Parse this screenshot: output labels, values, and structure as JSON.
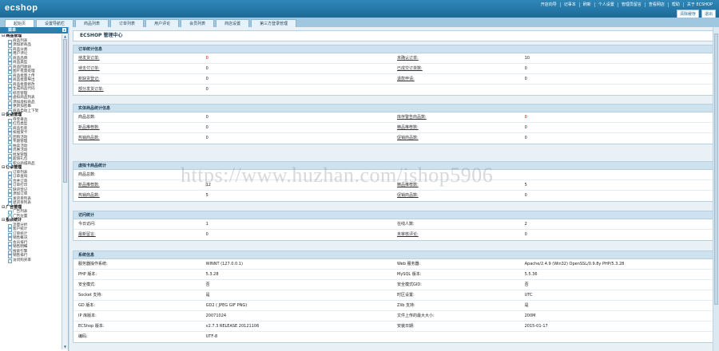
{
  "header": {
    "logo": "ecshop",
    "links": [
      "开店向导",
      "记事本",
      "刷新",
      "个人设置",
      "管理员留言",
      "查看网店",
      "帮助",
      "关于 ECSHOP"
    ],
    "buttons": [
      "清除缓存",
      "退出"
    ]
  },
  "nav": {
    "tabs": [
      "起始页",
      "设置导航栏",
      "商品列表",
      "订单列表",
      "用户评论",
      "会员列表",
      "商店设置",
      "第三方登录管理"
    ]
  },
  "sidebar": {
    "title": "菜单",
    "close": "x",
    "groups": [
      {
        "label": "商品管理",
        "items": [
          "商品列表",
          "添加新商品",
          "商品分类",
          "用户评论",
          "商品品牌",
          "商品类型",
          "商品回收站",
          "图片批量处理",
          "商品批量上传",
          "商品批量导出",
          "商品批量修改",
          "生成商品代码",
          "标签管理",
          "虚拟商品列表",
          "添加虚拟商品",
          "更新加密串",
          "商品自动上下架"
        ]
      },
      {
        "label": "促销管理",
        "items": [
          "夺宝奇兵",
          "红包类型",
          "商品包装",
          "祝福贺卡",
          "团购活动",
          "专题管理",
          "拍卖活动",
          "优惠活动",
          "批发管理",
          "超值礼包",
          "积分商城商品"
        ]
      },
      {
        "label": "订单管理",
        "items": [
          "订单列表",
          "订单查询",
          "合并订单",
          "订单打印",
          "缺货登记",
          "添加订单",
          "发货单列表",
          "退货单列表"
        ]
      },
      {
        "label": "广告管理",
        "items": [
          "广告列表",
          "广告位置"
        ]
      },
      {
        "label": "报表统计",
        "items": [
          "流量分析",
          "客户统计",
          "订单统计",
          "销售概况",
          "会员排行",
          "销售明细",
          "搜索引擎",
          "销售排行",
          "访问购买率"
        ]
      }
    ]
  },
  "main": {
    "title": "ECSHOP 管理中心",
    "panels": [
      {
        "title": "订单统计信息",
        "rows": [
          [
            {
              "t": "待发货订单:",
              "lnk": true
            },
            {
              "t": "0",
              "red": true
            },
            {
              "t": "未确认订单:",
              "lnk": true
            },
            {
              "t": "10",
              "red": false
            }
          ],
          [
            {
              "t": "待支付订单:",
              "lnk": true
            },
            {
              "t": "0"
            },
            {
              "t": "已成交订单数:",
              "lnk": true
            },
            {
              "t": "0"
            }
          ],
          [
            {
              "t": "新缺货登记:",
              "lnk": true
            },
            {
              "t": "0"
            },
            {
              "t": "退款申请:",
              "lnk": true
            },
            {
              "t": "0"
            }
          ],
          [
            {
              "t": "部分发货订单:",
              "lnk": true
            },
            {
              "t": "0"
            },
            {
              "t": ""
            },
            {
              "t": ""
            }
          ]
        ]
      },
      {
        "title": "实体商品统计信息",
        "rows": [
          [
            {
              "t": "商品总数:"
            },
            {
              "t": "0"
            },
            {
              "t": "库存警告商品数:",
              "lnk": true
            },
            {
              "t": "0",
              "red": true
            }
          ],
          [
            {
              "t": "新品推荐数:",
              "lnk": true
            },
            {
              "t": "0"
            },
            {
              "t": "精品推荐数:",
              "lnk": true
            },
            {
              "t": "0"
            }
          ],
          [
            {
              "t": "热销商品数:",
              "lnk": true
            },
            {
              "t": "0"
            },
            {
              "t": "促销商品数:",
              "lnk": true
            },
            {
              "t": "0"
            }
          ]
        ]
      },
      {
        "title": "虚拟卡商品统计",
        "rows": [
          [
            {
              "t": "商品总数:"
            },
            {
              "t": ""
            },
            {
              "t": ""
            },
            {
              "t": ""
            }
          ],
          [
            {
              "t": "新品推荐数:",
              "lnk": true
            },
            {
              "t": "12"
            },
            {
              "t": "精品推荐数:",
              "lnk": true
            },
            {
              "t": "5"
            }
          ],
          [
            {
              "t": "热销商品数:",
              "lnk": true
            },
            {
              "t": "5"
            },
            {
              "t": "促销商品数:",
              "lnk": true
            },
            {
              "t": "0"
            }
          ]
        ]
      },
      {
        "title": "访问统计",
        "rows": [
          [
            {
              "t": "今日访问:"
            },
            {
              "t": "1"
            },
            {
              "t": "在线人数:"
            },
            {
              "t": "2"
            }
          ],
          [
            {
              "t": "最新留言:",
              "lnk": true
            },
            {
              "t": "0"
            },
            {
              "t": "未审核评论:",
              "lnk": true
            },
            {
              "t": "0"
            }
          ]
        ]
      },
      {
        "title": "系统信息",
        "rows": [
          [
            {
              "t": "服务器操作系统:"
            },
            {
              "t": "WINNT (127.0.0.1)"
            },
            {
              "t": "Web 服务器:"
            },
            {
              "t": "Apache/2.4.9 (Win32) OpenSSL/0.9.8y PHP/5.3.28"
            }
          ],
          [
            {
              "t": "PHP 版本:"
            },
            {
              "t": "5.3.28"
            },
            {
              "t": "MySQL 版本:"
            },
            {
              "t": "5.5.36"
            }
          ],
          [
            {
              "t": "安全模式:"
            },
            {
              "t": "否"
            },
            {
              "t": "安全模式GID:"
            },
            {
              "t": "否"
            }
          ],
          [
            {
              "t": "Socket 支持:"
            },
            {
              "t": "是"
            },
            {
              "t": "时区设置:"
            },
            {
              "t": "UTC"
            }
          ],
          [
            {
              "t": "GD 版本:"
            },
            {
              "t": "GD2 ( JPEG GIF PNG)"
            },
            {
              "t": "Zlib 支持:"
            },
            {
              "t": "是"
            }
          ],
          [
            {
              "t": "IP 库版本:"
            },
            {
              "t": "20071024"
            },
            {
              "t": "文件上传的最大大小:"
            },
            {
              "t": "200M"
            }
          ],
          [
            {
              "t": "ECShop 版本:"
            },
            {
              "t": "v2.7.3 RELEASE 20121106"
            },
            {
              "t": "安装日期:"
            },
            {
              "t": "2015-01-17"
            }
          ],
          [
            {
              "t": "编码:"
            },
            {
              "t": "UTF-8"
            },
            {
              "t": ""
            },
            {
              "t": ""
            }
          ]
        ]
      }
    ]
  },
  "watermark": "https://www.huzhan.com/ishop5906"
}
